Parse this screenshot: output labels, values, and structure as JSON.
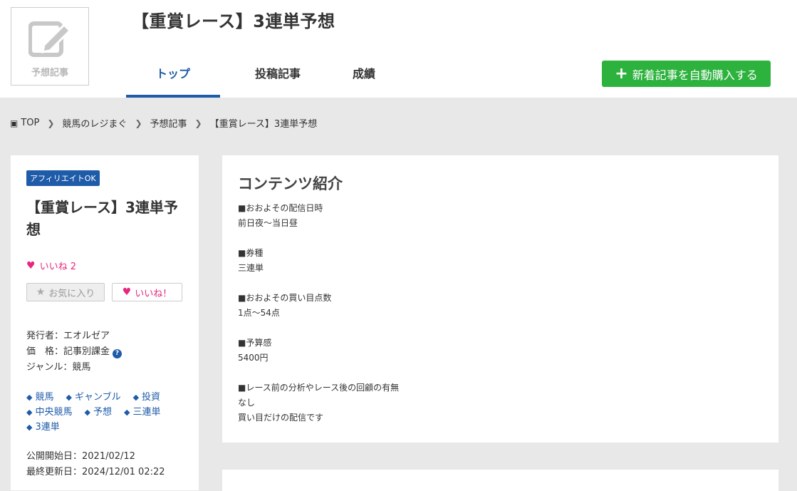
{
  "logo": {
    "label": "予想記事",
    "icon": "pencil-edit-icon"
  },
  "site_title": "【重賞レース】3連単予想",
  "nav": {
    "tabs": [
      {
        "label": "トップ"
      },
      {
        "label": "投稿記事"
      },
      {
        "label": "成績"
      }
    ]
  },
  "buy_button": {
    "label": "新着記事を自動購入する",
    "color": "#2db23e"
  },
  "breadcrumb": [
    "TOP",
    "競馬のレジまぐ",
    "予想記事",
    "【重賞レース】3連単予想"
  ],
  "sidebar": {
    "badge": "アフィリエイトOK",
    "title": "【重賞レース】3連単予想",
    "likes": "いいね 2",
    "favorite_button": "お気に入り",
    "like_button": "いいね！",
    "publisher": "発行者：エオルゼア",
    "price": "価　格：記事別課金",
    "genre": "ジャンル：競馬",
    "tags": [
      "競馬",
      "ギャンブル",
      "投資",
      "中央競馬",
      "予想",
      "三連単",
      "3連単"
    ],
    "start_date": "公開開始日：2021/02/12",
    "updated_date": "最終更新日：2024/12/01 02:22"
  },
  "content": {
    "title": "コンテンツ紹介",
    "lines": [
      "■おおよその配信日時",
      "前日夜～当日昼",
      "",
      "■券種",
      "三連単",
      "",
      "■おおよその買い目点数",
      "1点～54点",
      "",
      "■予算感",
      "5400円",
      "",
      "■レース前の分析やレース後の回顧の有無",
      "なし",
      "買い目だけの配信です"
    ]
  },
  "colors": {
    "accent": "#1e5ba8",
    "like": "#e8267f",
    "background": "#e8e8e8"
  }
}
